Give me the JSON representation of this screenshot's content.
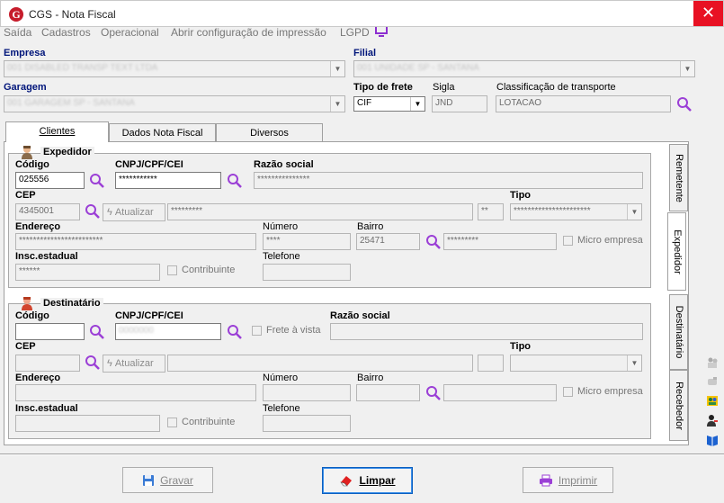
{
  "window": {
    "title": "CGS - Nota Fiscal",
    "logo_letter": "G"
  },
  "menu": [
    "Saída",
    "Cadastros",
    "Operacional",
    "Abrir configuração de impressão",
    "LGPD"
  ],
  "header": {
    "empresa_label": "Empresa",
    "empresa_value": "001 DISABLED TRANSP TEXT LTDA",
    "filial_label": "Filial",
    "filial_value": "001 UNIDADE SP - SANTANA",
    "garagem_label": "Garagem",
    "garagem_value": "001 GARAGEM SP - SANTANA",
    "tipo_frete_label": "Tipo de frete",
    "tipo_frete_value": "CIF",
    "sigla_label": "Sigla",
    "sigla_value": "JND",
    "classificacao_label": "Classificação de transporte",
    "classificacao_value": "LOTACAO"
  },
  "tabs": [
    "Clientes",
    "Dados Nota Fiscal",
    "Diversos"
  ],
  "side_tabs": [
    "Remetente",
    "Expedidor",
    "Destinatário",
    "Recebedor"
  ],
  "expedidor": {
    "title": "Expedidor",
    "codigo_label": "Código",
    "codigo_value": "025556",
    "cnpj_label": "CNPJ/CPF/CEI",
    "cnpj_value": "***********",
    "razao_label": "Razão social",
    "razao_value": "***************",
    "cep_label": "CEP",
    "cep_value": "4345001",
    "atualizar_label": "Atualizar",
    "cep_street_value": "*********",
    "uf_value": "**",
    "tipo_label": "Tipo",
    "tipo_value": "**********************",
    "endereco_label": "Endereço",
    "endereco_value": "************************",
    "numero_label": "Número",
    "numero_value": "****",
    "bairro_label": "Bairro",
    "bairro_value": "25471",
    "bairro_desc_value": "*********",
    "micro_label": "Micro empresa",
    "insc_label": "Insc.estadual",
    "insc_value": "******",
    "contribuinte_label": "Contribuinte",
    "telefone_label": "Telefone",
    "telefone_value": ""
  },
  "destinatario": {
    "title": "Destinatário",
    "codigo_label": "Código",
    "codigo_value": "",
    "cnpj_label": "CNPJ/CPF/CEI",
    "cnpj_value": "0000000",
    "frete_vista_label": "Frete à vista",
    "razao_label": "Razão social",
    "razao_value": "",
    "cep_label": "CEP",
    "cep_value": "",
    "atualizar_label": "Atualizar",
    "tipo_label": "Tipo",
    "tipo_value": "",
    "endereco_label": "Endereço",
    "endereco_value": "",
    "numero_label": "Número",
    "numero_value": "",
    "bairro_label": "Bairro",
    "bairro_value": "",
    "micro_label": "Micro empresa",
    "insc_label": "Insc.estadual",
    "insc_value": "",
    "contribuinte_label": "Contribuinte",
    "telefone_label": "Telefone",
    "telefone_value": ""
  },
  "buttons": {
    "gravar": "Gravar",
    "limpar": "Limpar",
    "imprimir": "Imprimir"
  },
  "colors": {
    "accent": "#c61c2b",
    "label_blue": "#00157a",
    "search_icon": "#9b3fd6",
    "close": "#e81123"
  }
}
